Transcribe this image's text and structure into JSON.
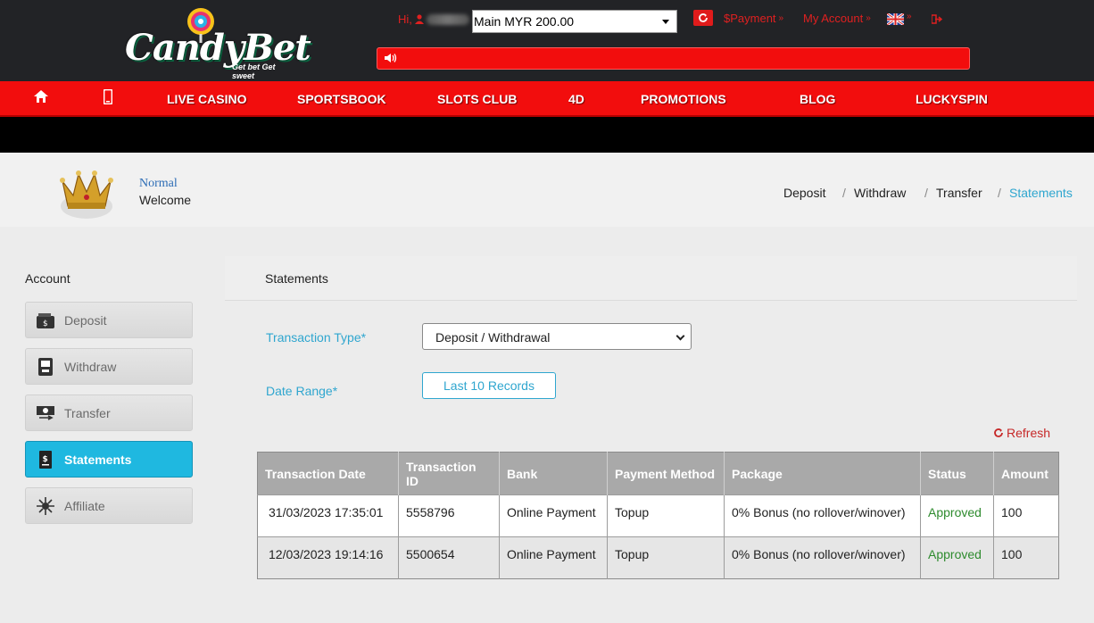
{
  "header": {
    "logo_text": "CandyBet",
    "logo_tagline": "Get bet Get sweet",
    "greeting": "Hi,",
    "wallet_selected": "Main MYR 200.00",
    "payment_label": "$Payment",
    "account_label": "My Account"
  },
  "nav": {
    "items": [
      "LIVE CASINO",
      "SPORTSBOOK",
      "SLOTS CLUB",
      "4D",
      "PROMOTIONS",
      "BLOG",
      "LUCKYSPIN"
    ]
  },
  "profile": {
    "level": "Normal",
    "welcome": "Welcome"
  },
  "breadcrumb": {
    "items": [
      "Deposit",
      "Withdraw",
      "Transfer",
      "Statements"
    ],
    "separator": "/"
  },
  "sidebar": {
    "title": "Account",
    "items": [
      {
        "label": "Deposit",
        "icon": "wallet-icon"
      },
      {
        "label": "Withdraw",
        "icon": "atm-icon"
      },
      {
        "label": "Transfer",
        "icon": "money-transfer-icon"
      },
      {
        "label": "Statements",
        "icon": "statement-icon"
      },
      {
        "label": "Affiliate",
        "icon": "network-icon"
      }
    ],
    "active": "Statements"
  },
  "main": {
    "title": "Statements",
    "transaction_type_label": "Transaction Type*",
    "transaction_type_value": "Deposit / Withdrawal",
    "date_range_label": "Date Range*",
    "date_range_button": "Last 10 Records",
    "refresh_label": "Refresh"
  },
  "table": {
    "headers": [
      "Transaction Date",
      "Transaction ID",
      "Bank",
      "Payment Method",
      "Package",
      "Status",
      "Amount"
    ],
    "rows": [
      [
        "31/03/2023 17:35:01",
        "5558796",
        "Online Payment",
        "Topup",
        "0% Bonus (no rollover/winover)",
        "Approved",
        "100"
      ],
      [
        "12/03/2023 19:14:16",
        "5500654",
        "Online Payment",
        "Topup",
        "0% Bonus (no rollover/winover)",
        "Approved",
        "100"
      ]
    ]
  },
  "colors": {
    "brand_red": "#f20d0d",
    "accent_blue": "#1fb8e0",
    "approved_green": "#2e8b2e"
  }
}
